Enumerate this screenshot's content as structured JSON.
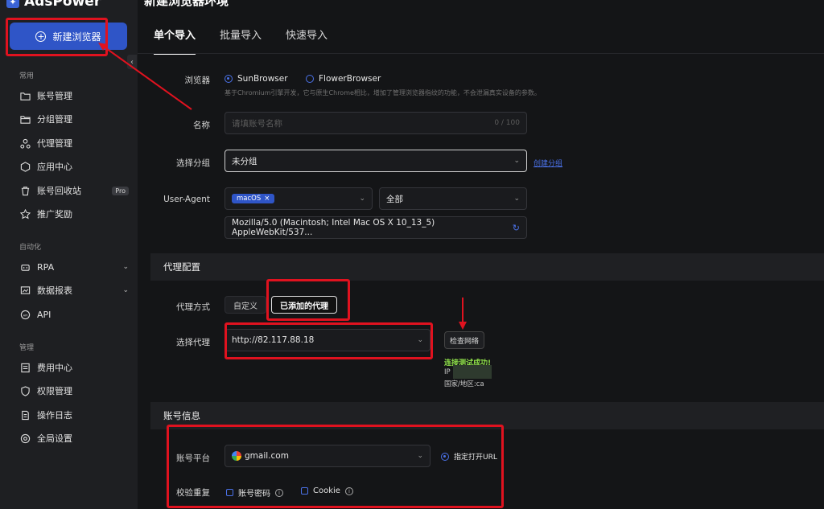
{
  "app": {
    "name": "AdsPower",
    "page_title": "新建浏览器环境"
  },
  "sidebar": {
    "new_browser_label": "新建浏览器",
    "sections": {
      "common": "常用",
      "automation": "自动化",
      "manage": "管理"
    },
    "items": {
      "accounts": "账号管理",
      "groups": "分组管理",
      "proxy": "代理管理",
      "apps": "应用中心",
      "recycle": "账号回收站",
      "pro_badge": "Pro",
      "promo": "推广奖励",
      "rpa": "RPA",
      "reports": "数据报表",
      "api": "API",
      "billing": "费用中心",
      "permissions": "权限管理",
      "logs": "操作日志",
      "settings": "全局设置"
    }
  },
  "tabs": [
    "单个导入",
    "批量导入",
    "快速导入"
  ],
  "form": {
    "browser": {
      "label": "浏览器",
      "option_1": "SunBrowser",
      "option_2": "FlowerBrowser",
      "hint": "基于Chromium引擎开发，它与原生Chrome相比，增加了管理浏览器指纹的功能，不会泄漏真实设备的参数。"
    },
    "name": {
      "label": "名称",
      "placeholder": "请填账号名称",
      "counter": "0 / 100"
    },
    "group": {
      "label": "选择分组",
      "value": "未分组",
      "create_link": "创建分组"
    },
    "user_agent": {
      "label": "User-Agent",
      "os_tag": "macOS",
      "version_value": "全部",
      "ua_string": "Mozilla/5.0 (Macintosh; Intel Mac OS X 10_13_5) AppleWebKit/537..."
    }
  },
  "proxy_section": {
    "title": "代理配置",
    "mode_label": "代理方式",
    "modes": [
      "自定义",
      "已添加的代理"
    ],
    "select_label": "选择代理",
    "proxy_value": "http://82.117.88.18",
    "check_button": "检查网络",
    "success_text": "连接测试成功!",
    "ip_prefix": "IP",
    "country_text": "国家/地区:ca"
  },
  "account_section": {
    "title": "账号信息",
    "platform_label": "账号平台",
    "platform_value": "gmail.com",
    "open_url_label": "指定打开URL",
    "dedupe_label": "校验重复",
    "check_1": "账号密码",
    "check_2": "Cookie"
  },
  "colors": {
    "accent": "#2f55c7",
    "annotation_red": "#e0121f",
    "success_green": "#8fe04a"
  }
}
